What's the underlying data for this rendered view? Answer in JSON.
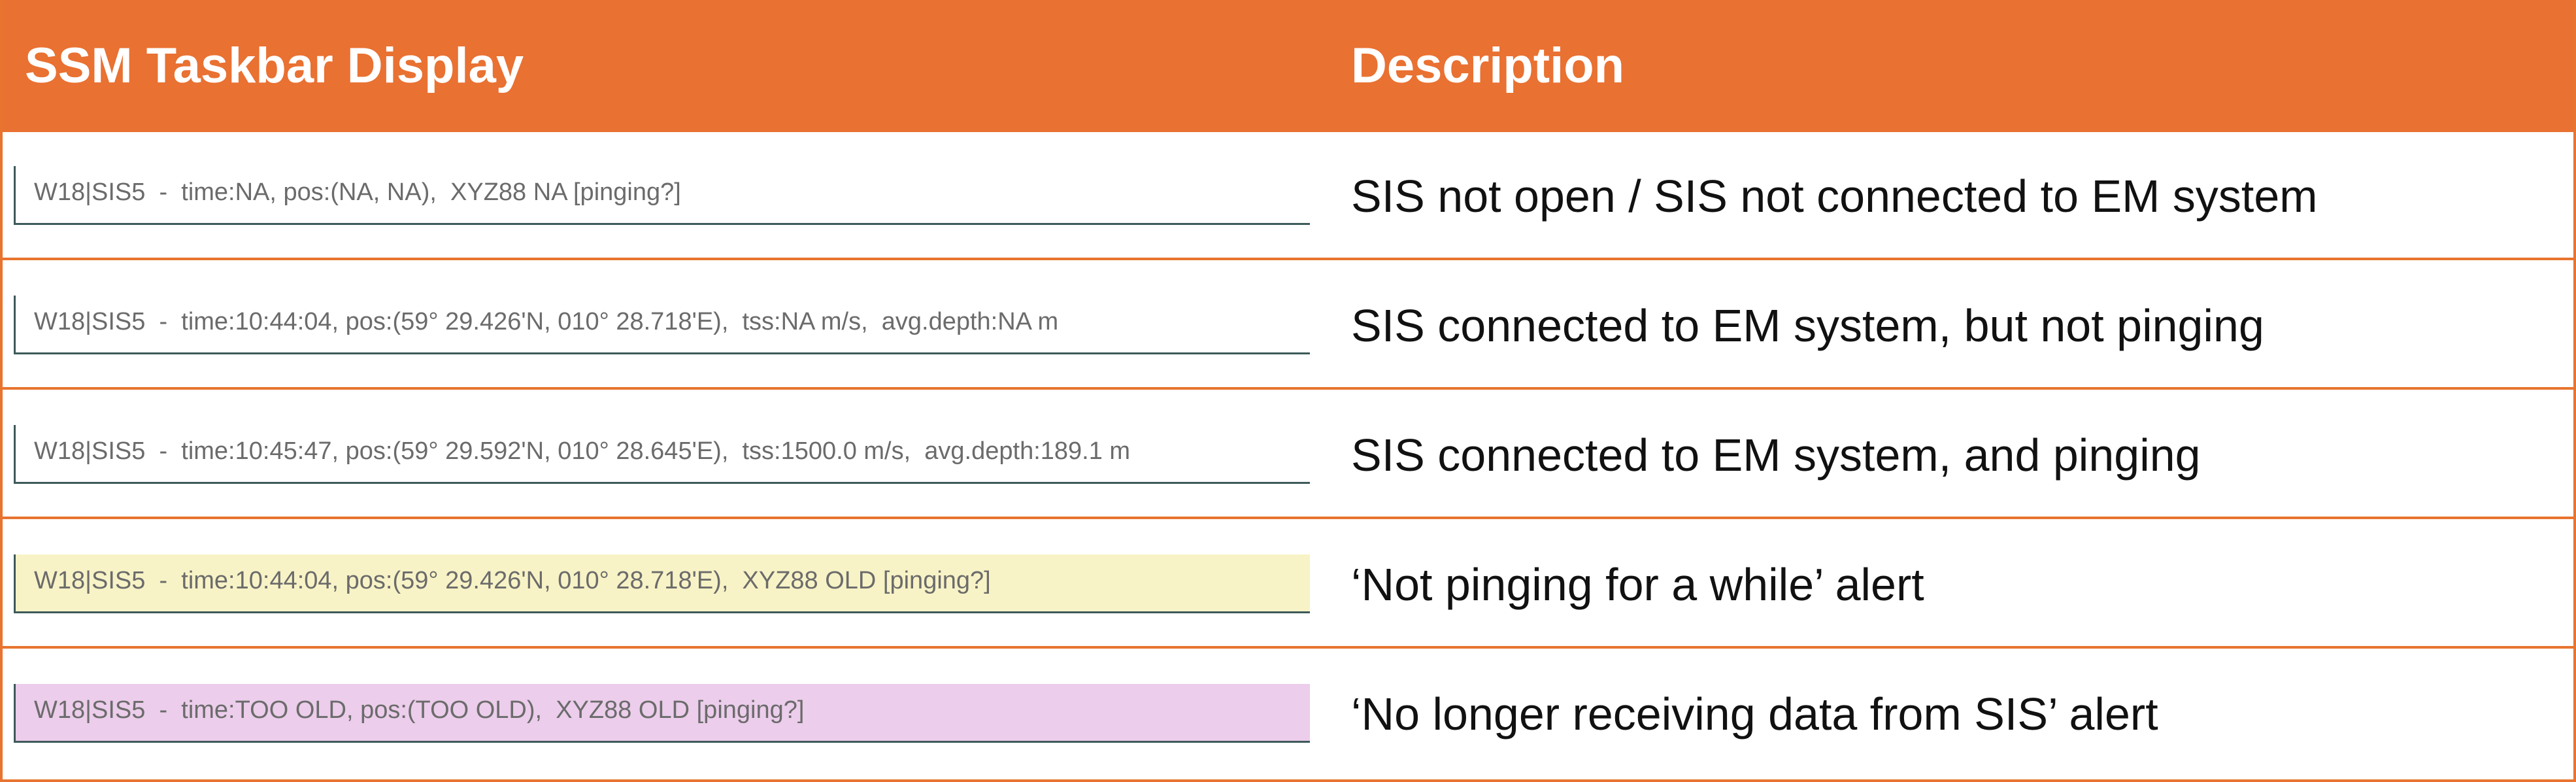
{
  "header": {
    "col1": "SSM Taskbar Display",
    "col2": "Description"
  },
  "colors": {
    "header_bg": "#e97132",
    "header_text": "#ffffff",
    "row_border": "#e8742f",
    "alert_old_bg": "#f8f3c6",
    "alert_stale_bg": "#eccdeb",
    "bar_border": "#3d5a5a",
    "bar_text": "#6b6b6b"
  },
  "rows": [
    {
      "taskbar": "W18|SIS5  -  time:NA, pos:(NA, NA),  XYZ88 NA [pinging?]",
      "description": "SIS not open / SIS not connected to EM system",
      "bg": "#ffffff"
    },
    {
      "taskbar": "W18|SIS5  -  time:10:44:04, pos:(59° 29.426'N, 010° 28.718'E),  tss:NA m/s,  avg.depth:NA m",
      "description": "SIS connected to EM system, but not pinging",
      "bg": "#ffffff"
    },
    {
      "taskbar": "W18|SIS5  -  time:10:45:47, pos:(59° 29.592'N, 010° 28.645'E),  tss:1500.0 m/s,  avg.depth:189.1 m",
      "description": "SIS connected to EM system, and pinging",
      "bg": "#ffffff"
    },
    {
      "taskbar": "W18|SIS5  -  time:10:44:04, pos:(59° 29.426'N, 010° 28.718'E),  XYZ88 OLD [pinging?]",
      "description": "‘Not pinging for a while’ alert",
      "bg": "#f8f3c6"
    },
    {
      "taskbar": "W18|SIS5  -  time:TOO OLD, pos:(TOO OLD),  XYZ88 OLD [pinging?]",
      "description": "‘No longer receiving data from SIS’ alert",
      "bg": "#eccdeb"
    }
  ]
}
